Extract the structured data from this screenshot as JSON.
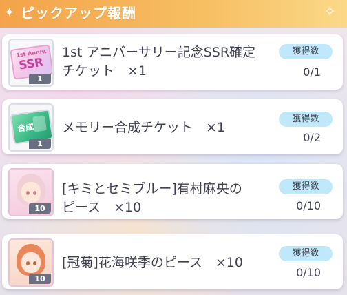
{
  "header": {
    "title": "ピックアップ報酬"
  },
  "badge_label": "獲得数",
  "rewards": [
    {
      "name": "1st アニバーサリー記念SSR確定\nチケット　×1",
      "icon": "ssr-ticket-icon",
      "icon_text": "SSR",
      "icon_subtext": "1st Anniv.",
      "count": "1",
      "progress": "0/1"
    },
    {
      "name": "メモリー合成チケット　×1",
      "icon": "memory-synthesis-ticket-icon",
      "icon_text": "合成",
      "count": "1",
      "progress": "0/2"
    },
    {
      "name": "[キミとセミブルー]有村麻央の\nピース　×10",
      "icon": "character-portrait-icon",
      "count": "10",
      "progress": "0/10"
    },
    {
      "name": "[冠菊]花海咲季のピース　×10",
      "icon": "character-portrait-icon",
      "count": "10",
      "progress": "0/10"
    }
  ],
  "colors": {
    "header_start": "#f4a34a",
    "header_end": "#fad989",
    "badge_bg": "#bfe9fb",
    "text": "#3f4151"
  }
}
